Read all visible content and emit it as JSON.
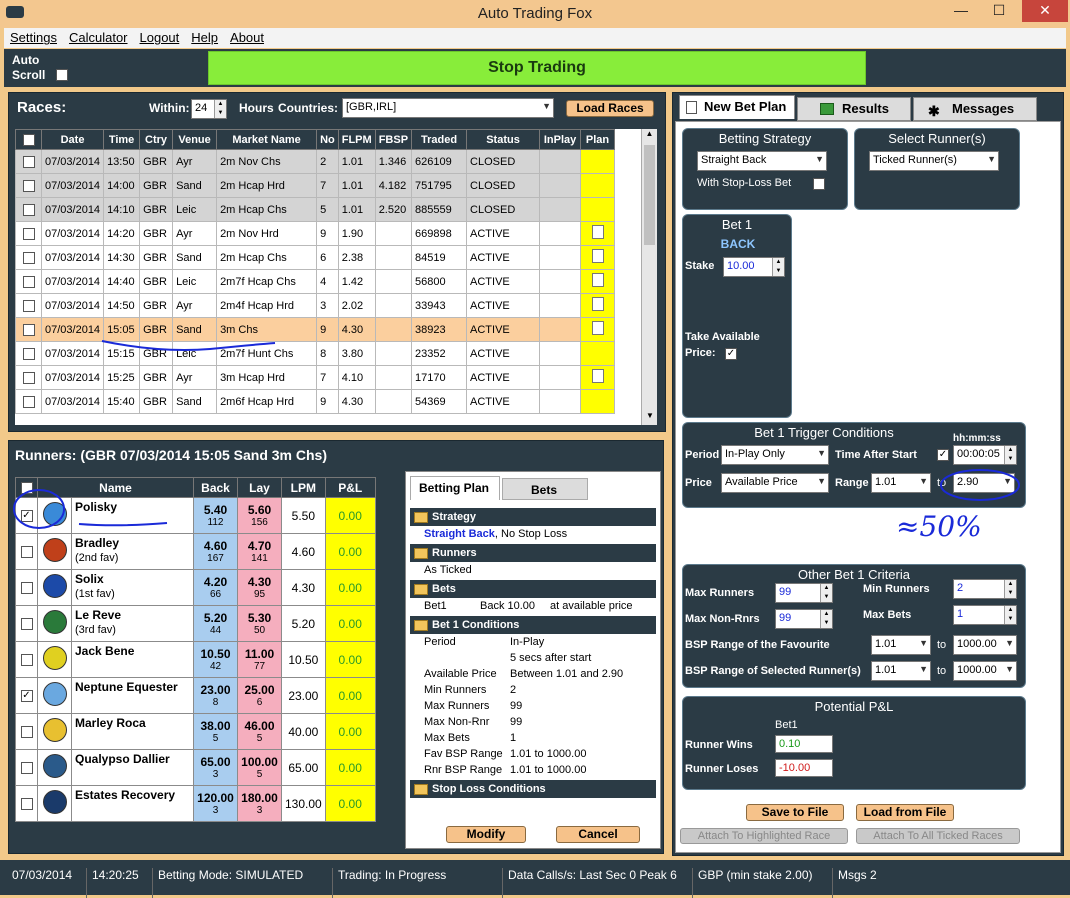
{
  "app": {
    "title": "Auto Trading Fox",
    "stop_trading": "Stop Trading",
    "auto_scroll": "Auto Scroll"
  },
  "menu": [
    "Settings",
    "Calculator",
    "Logout",
    "Help",
    "About"
  ],
  "races": {
    "title": "Races:",
    "within_label": "Within:",
    "within_value": "24",
    "hours_label": "Hours",
    "countries_label": "Countries:",
    "countries_value": "[GBR,IRL]",
    "load_button": "Load Races",
    "columns": [
      "",
      "Date",
      "Time",
      "Ctry",
      "Venue",
      "Market Name",
      "No",
      "FLPM",
      "FBSP",
      "Traded",
      "Status",
      "InPlay",
      "Plan"
    ],
    "rows": [
      {
        "date": "07/03/2014",
        "time": "13:50",
        "ctry": "GBR",
        "venue": "Ayr",
        "market": "2m Nov Chs",
        "no": "2",
        "flpm": "1.01",
        "fbsp": "1.346",
        "traded": "626109",
        "status": "CLOSED",
        "plan": false,
        "state": "closed"
      },
      {
        "date": "07/03/2014",
        "time": "14:00",
        "ctry": "GBR",
        "venue": "Sand",
        "market": "2m Hcap Hrd",
        "no": "7",
        "flpm": "1.01",
        "fbsp": "4.182",
        "traded": "751795",
        "status": "CLOSED",
        "plan": false,
        "state": "closed"
      },
      {
        "date": "07/03/2014",
        "time": "14:10",
        "ctry": "GBR",
        "venue": "Leic",
        "market": "2m Hcap Chs",
        "no": "5",
        "flpm": "1.01",
        "fbsp": "2.520",
        "traded": "885559",
        "status": "CLOSED",
        "plan": false,
        "state": "closed"
      },
      {
        "date": "07/03/2014",
        "time": "14:20",
        "ctry": "GBR",
        "venue": "Ayr",
        "market": "2m Nov Hrd",
        "no": "9",
        "flpm": "1.90",
        "fbsp": "",
        "traded": "669898",
        "status": "ACTIVE",
        "plan": true,
        "state": "active"
      },
      {
        "date": "07/03/2014",
        "time": "14:30",
        "ctry": "GBR",
        "venue": "Sand",
        "market": "2m Hcap Chs",
        "no": "6",
        "flpm": "2.38",
        "fbsp": "",
        "traded": "84519",
        "status": "ACTIVE",
        "plan": true,
        "state": "active"
      },
      {
        "date": "07/03/2014",
        "time": "14:40",
        "ctry": "GBR",
        "venue": "Leic",
        "market": "2m7f Hcap Chs",
        "no": "4",
        "flpm": "1.42",
        "fbsp": "",
        "traded": "56800",
        "status": "ACTIVE",
        "plan": true,
        "state": "active"
      },
      {
        "date": "07/03/2014",
        "time": "14:50",
        "ctry": "GBR",
        "venue": "Ayr",
        "market": "2m4f Hcap Hrd",
        "no": "3",
        "flpm": "2.02",
        "fbsp": "",
        "traded": "33943",
        "status": "ACTIVE",
        "plan": true,
        "state": "active"
      },
      {
        "date": "07/03/2014",
        "time": "15:05",
        "ctry": "GBR",
        "venue": "Sand",
        "market": "3m Chs",
        "no": "9",
        "flpm": "4.30",
        "fbsp": "",
        "traded": "38923",
        "status": "ACTIVE",
        "plan": true,
        "state": "sel"
      },
      {
        "date": "07/03/2014",
        "time": "15:15",
        "ctry": "GBR",
        "venue": "Leic",
        "market": "2m7f Hunt Chs",
        "no": "8",
        "flpm": "3.80",
        "fbsp": "",
        "traded": "23352",
        "status": "ACTIVE",
        "plan": false,
        "state": "active"
      },
      {
        "date": "07/03/2014",
        "time": "15:25",
        "ctry": "GBR",
        "venue": "Ayr",
        "market": "3m Hcap Hrd",
        "no": "7",
        "flpm": "4.10",
        "fbsp": "",
        "traded": "17170",
        "status": "ACTIVE",
        "plan": true,
        "state": "active"
      },
      {
        "date": "07/03/2014",
        "time": "15:40",
        "ctry": "GBR",
        "venue": "Sand",
        "market": "2m6f Hcap Hrd",
        "no": "9",
        "flpm": "4.30",
        "fbsp": "",
        "traded": "54369",
        "status": "ACTIVE",
        "plan": false,
        "state": "active"
      }
    ]
  },
  "runners": {
    "title": "Runners:  (GBR 07/03/2014 15:05 Sand  3m Chs)",
    "columns": [
      "",
      "Name",
      "Back",
      "Lay",
      "LPM",
      "P&L"
    ],
    "rows": [
      {
        "checked": true,
        "name": "Polisky",
        "sub": "",
        "back": "5.40",
        "back_vol": "112",
        "lay": "5.60",
        "lay_vol": "156",
        "lpm": "5.50",
        "pl": "0.00",
        "silk": "#3a8ad8"
      },
      {
        "checked": false,
        "name": "Bradley",
        "sub": "(2nd fav)",
        "back": "4.60",
        "back_vol": "167",
        "lay": "4.70",
        "lay_vol": "141",
        "lpm": "4.60",
        "pl": "0.00",
        "silk": "#c0401a"
      },
      {
        "checked": false,
        "name": "Solix",
        "sub": "(1st fav)",
        "back": "4.20",
        "back_vol": "66",
        "lay": "4.30",
        "lay_vol": "95",
        "lpm": "4.30",
        "pl": "0.00",
        "silk": "#1c4aa8"
      },
      {
        "checked": false,
        "name": "Le Reve",
        "sub": "(3rd fav)",
        "back": "5.20",
        "back_vol": "44",
        "lay": "5.30",
        "lay_vol": "50",
        "lpm": "5.20",
        "pl": "0.00",
        "silk": "#2a7a3a"
      },
      {
        "checked": false,
        "name": "Jack Bene",
        "sub": "",
        "back": "10.50",
        "back_vol": "42",
        "lay": "11.00",
        "lay_vol": "77",
        "lpm": "10.50",
        "pl": "0.00",
        "silk": "#e0d020"
      },
      {
        "checked": true,
        "name": "Neptune Equester",
        "sub": "",
        "back": "23.00",
        "back_vol": "8",
        "lay": "25.00",
        "lay_vol": "6",
        "lpm": "23.00",
        "pl": "0.00",
        "silk": "#6aa8e0"
      },
      {
        "checked": false,
        "name": "Marley Roca",
        "sub": "",
        "back": "38.00",
        "back_vol": "5",
        "lay": "46.00",
        "lay_vol": "5",
        "lpm": "40.00",
        "pl": "0.00",
        "silk": "#e8c030"
      },
      {
        "checked": false,
        "name": "Qualypso Dallier",
        "sub": "",
        "back": "65.00",
        "back_vol": "3",
        "lay": "100.00",
        "lay_vol": "5",
        "lpm": "65.00",
        "pl": "0.00",
        "silk": "#2a5a8a"
      },
      {
        "checked": false,
        "name": "Estates Recovery",
        "sub": "",
        "back": "120.00",
        "back_vol": "3",
        "lay": "180.00",
        "lay_vol": "3",
        "lpm": "130.00",
        "pl": "0.00",
        "silk": "#1a3a6a"
      }
    ]
  },
  "betting_plan": {
    "tabs": [
      "Betting Plan",
      "Bets"
    ],
    "strategy_head": "Strategy",
    "strategy_name": "Straight Back",
    "strategy_rest": ", No Stop Loss",
    "runners_head": "Runners",
    "runners_val": "As Ticked",
    "bets_head": "Bets",
    "bets_row": [
      "Bet1",
      "Back  10.00",
      "at available price"
    ],
    "cond_head": "Bet 1 Conditions",
    "cond_rows": [
      [
        "Period",
        "In-Play"
      ],
      [
        "",
        "5 secs after start"
      ],
      [
        "Available Price",
        "Between 1.01 and 2.90"
      ],
      [
        "Min Runners",
        "2"
      ],
      [
        "Max Runners",
        "99"
      ],
      [
        "Max Non-Rnr",
        "99"
      ],
      [
        "Max Bets",
        "1"
      ],
      [
        "Fav BSP Range",
        "1.01 to 1000.00"
      ],
      [
        "Rnr BSP Range",
        "1.01 to 1000.00"
      ]
    ],
    "stoploss_head": "Stop Loss Conditions",
    "modify": "Modify",
    "cancel": "Cancel"
  },
  "right": {
    "tabs": [
      "New Bet Plan",
      "Results",
      "Messages"
    ],
    "betting_strategy": {
      "title": "Betting  Strategy",
      "value": "Straight Back",
      "stoploss_label": "With Stop-Loss Bet"
    },
    "select_runner": {
      "title": "Select Runner(s)",
      "value": "Ticked Runner(s)"
    },
    "bet1": {
      "title": "Bet 1",
      "type": "BACK",
      "stake_label": "Stake",
      "stake": "10.00",
      "take_label": "Take Available",
      "price_label": "Price:"
    },
    "trigger": {
      "title": "Bet 1 Trigger Conditions",
      "hhmmss": "hh:mm:ss",
      "period_label": "Period",
      "period": "In-Play Only",
      "tas_label": "Time After Start",
      "tas": "00:00:05",
      "price_label": "Price",
      "price": "Available Price",
      "range_label": "Range",
      "range_from": "1.01",
      "to": "to",
      "range_to": "2.90",
      "annotation": "≈50%"
    },
    "other": {
      "title": "Other Bet 1  Criteria",
      "max_runners_label": "Max Runners",
      "max_runners": "99",
      "min_runners_label": "Min Runners",
      "min_runners": "2",
      "max_nonrnrs_label": "Max Non-Rnrs",
      "max_nonrnrs": "99",
      "max_bets_label": "Max Bets",
      "max_bets": "1",
      "bsp_fav_label": "BSP Range of the Favourite",
      "bsp_fav_from": "1.01",
      "bsp_fav_to": "1000.00",
      "bsp_sel_label": "BSP Range of Selected Runner(s)",
      "bsp_sel_from": "1.01",
      "bsp_sel_to": "1000.00",
      "to": "to"
    },
    "potential": {
      "title": "Potential P&L",
      "col": "Bet1",
      "wins_label": "Runner Wins",
      "wins": "0.10",
      "loses_label": "Runner Loses",
      "loses": "-10.00"
    },
    "save": "Save to File",
    "load": "Load from File",
    "attach_hl": "Attach To Highlighted Race",
    "attach_all": "Attach To All Ticked Races"
  },
  "status": {
    "date": "07/03/2014",
    "time": "14:20:25",
    "mode": "Betting Mode: SIMULATED",
    "trading": "Trading: In Progress",
    "calls": "Data Calls/s: Last Sec 0  Peak 6",
    "currency": "GBP (min stake 2.00)",
    "msgs": "Msgs 2"
  }
}
